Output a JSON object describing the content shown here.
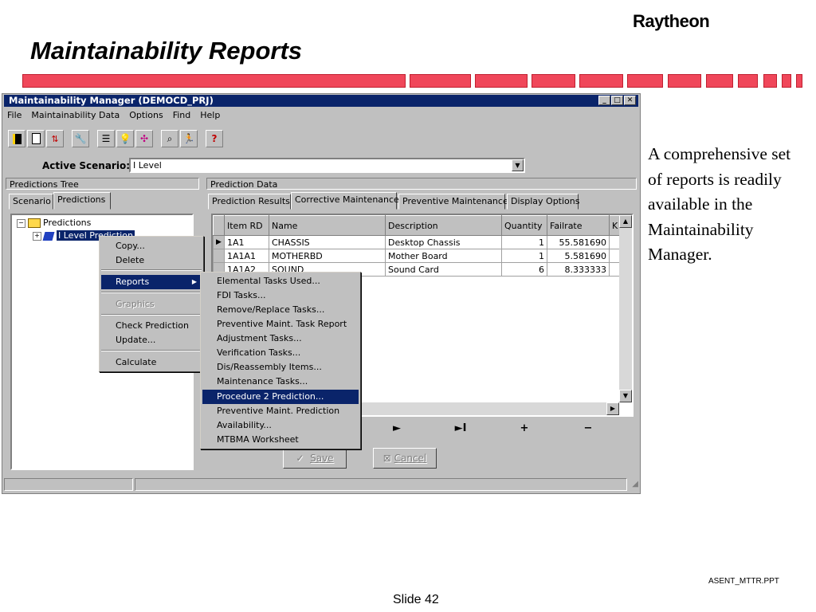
{
  "slide": {
    "title": "Maintainability Reports",
    "logo": "Raytheon",
    "side_text": "A comprehensive set of reports is readily available in the Maintainability Manager.",
    "footer_file": "ASENT_MTTR.PPT",
    "footer_slide": "Slide 42",
    "accent_color": "#f0475a"
  },
  "window": {
    "title": "Maintainability Manager (DEMOCD_PRJ)",
    "menu": [
      "File",
      "Maintainability Data",
      "Options",
      "Find",
      "Help"
    ],
    "toolbar_icons": [
      "close-book-icon",
      "new-document-icon",
      "sort-icon",
      "tools-icon",
      "list-icon",
      "lightbulb-icon",
      "chart-icon",
      "search-icon",
      "run-icon",
      "help-icon"
    ],
    "scenario_label": "Active Scenario:",
    "scenario_value": "I Level",
    "left_pane_title": "Predictions Tree",
    "left_tabs": [
      "Scenario",
      "Predictions"
    ],
    "tree": {
      "root": "Predictions",
      "child": "I Level Prediction"
    },
    "right_pane_title": "Prediction Data",
    "right_tabs": [
      "Prediction Results",
      "Corrective Maintenance",
      "Preventive Maintenance",
      "Display Options"
    ],
    "grid": {
      "columns": [
        "Item RD",
        "Name",
        "Description",
        "Quantity",
        "Failrate",
        "K"
      ],
      "rows": [
        [
          "1A1",
          "CHASSIS",
          "Desktop Chassis",
          "1",
          "55.581690"
        ],
        [
          "1A1A1",
          "MOTHERBD",
          "Mother Board",
          "1",
          "5.581690"
        ],
        [
          "1A1A2",
          "SOUND",
          "Sound Card",
          "6",
          "8.333333"
        ]
      ]
    },
    "nav": [
      "►",
      "►I",
      "+",
      "−"
    ],
    "save_label": "Save",
    "cancel_label": "Cancel"
  },
  "context_menu": {
    "items": [
      "Copy...",
      "Delete",
      "Reports",
      "Graphics",
      "Check Prediction",
      "Update...",
      "Calculate"
    ]
  },
  "reports_menu": {
    "items": [
      "Elemental Tasks Used...",
      "FDI Tasks...",
      "Remove/Replace Tasks...",
      "Preventive Maint. Task Report",
      "Adjustment Tasks...",
      "Verification Tasks...",
      "Dis/Reassembly Items...",
      "Maintenance Tasks...",
      "Procedure 2 Prediction...",
      "Preventive Maint. Prediction",
      "Availability...",
      "MTBMA Worksheet"
    ],
    "highlighted": "Procedure 2 Prediction..."
  }
}
